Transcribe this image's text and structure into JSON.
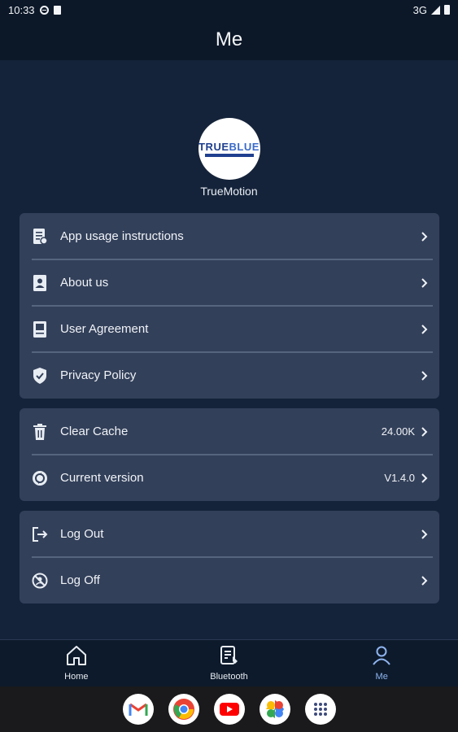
{
  "status_bar": {
    "time": "10:33",
    "network": "3G"
  },
  "header": {
    "title": "Me"
  },
  "profile": {
    "logo_text_1": "TRUE",
    "logo_text_2": "BLUE",
    "name": "TrueMotion"
  },
  "menu_group_1": [
    {
      "label": "App usage instructions",
      "icon": "document-info-icon"
    },
    {
      "label": "About us",
      "icon": "person-card-icon"
    },
    {
      "label": "User Agreement",
      "icon": "agreement-icon"
    },
    {
      "label": "Privacy Policy",
      "icon": "shield-check-icon"
    }
  ],
  "menu_group_2": [
    {
      "label": "Clear Cache",
      "value": "24.00K",
      "icon": "trash-icon"
    },
    {
      "label": "Current version",
      "value": "V1.4.0",
      "icon": "version-icon"
    }
  ],
  "menu_group_3": [
    {
      "label": "Log Out",
      "icon": "logout-icon"
    },
    {
      "label": "Log Off",
      "icon": "block-icon"
    }
  ],
  "bottom_nav": [
    {
      "label": "Home",
      "icon": "home-icon",
      "active": false
    },
    {
      "label": "Bluetooth",
      "icon": "bluetooth-form-icon",
      "active": false
    },
    {
      "label": "Me",
      "icon": "person-icon",
      "active": true
    }
  ],
  "dock_apps": [
    "gmail-icon",
    "chrome-icon",
    "youtube-icon",
    "photos-icon",
    "app-drawer-icon"
  ],
  "colors": {
    "background": "#15233a",
    "card": "#33405a",
    "active_tab": "#8fb5f0"
  }
}
